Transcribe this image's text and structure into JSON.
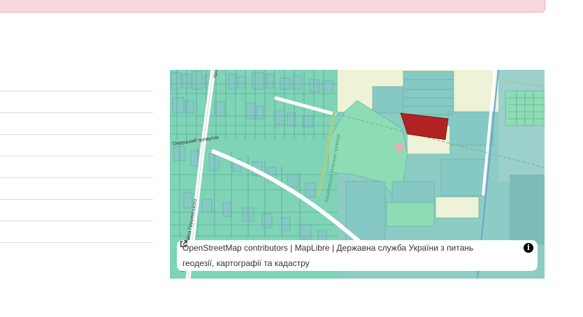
{
  "map": {
    "attribution": {
      "osm": "OpenStreetMap contributors",
      "sep1": "|",
      "maplibre": "MapLibre",
      "sep2": "|",
      "agency_line1": "Державна служба України з питань",
      "agency_line2": "геодезії, картографії та кадастру"
    },
    "street_labels": [
      "проспект Михайла Грушевського",
      "проспект Мі",
      "Кисилевська сільська громада",
      "Овруцький провулок"
    ],
    "icons": [
      "external-link-icon",
      "info-icon"
    ],
    "colors": {
      "alert_bg": "#f8d7da",
      "parcel_green": "#7fd8b4",
      "parcel_teal": "#86c9c4",
      "selected_parcel": "#b22222",
      "map_text": "#333333"
    }
  }
}
